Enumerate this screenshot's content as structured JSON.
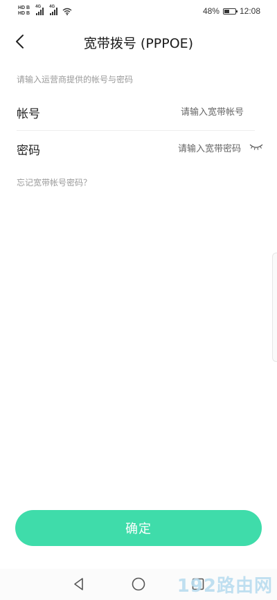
{
  "status_bar": {
    "hd_top": "HD B",
    "hd_bottom": "HD B",
    "network_1": "4G",
    "network_2": "4G",
    "battery_level": 48,
    "battery_text": "48%",
    "time": "12:08"
  },
  "header": {
    "title": "宽带拨号 (PPPOE)",
    "back_icon": "chevron-left-icon"
  },
  "form": {
    "hint": "请输入运营商提供的帐号与密码",
    "account": {
      "label": "帐号",
      "placeholder": "请输入宽带帐号",
      "value": ""
    },
    "password": {
      "label": "密码",
      "placeholder": "请输入宽带密码",
      "value": "",
      "toggle_icon": "eye-closed-icon"
    },
    "forgot_link": "忘记宽带帐号密码？"
  },
  "confirm_button": {
    "label": "确定",
    "color": "#3fdcaa"
  },
  "nav_bar": {
    "icons": [
      "back-triangle-icon",
      "home-circle-icon",
      "recent-square-icon"
    ]
  },
  "watermark": "192路由网"
}
